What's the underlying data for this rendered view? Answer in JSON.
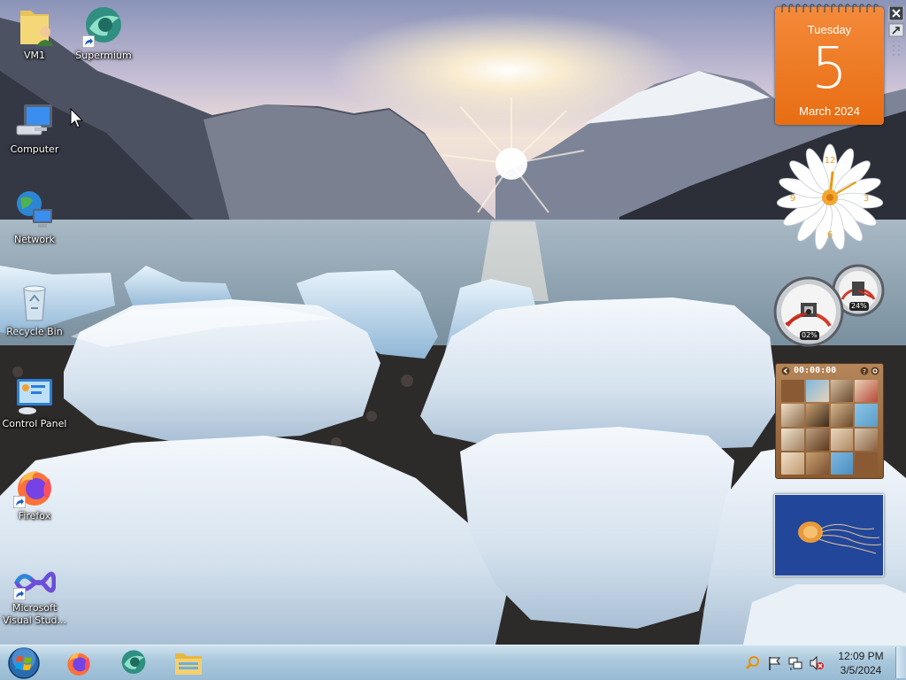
{
  "desktop": {
    "icons": [
      {
        "label": "VM1",
        "icon": "user-folder-icon",
        "shortcut": false
      },
      {
        "label": "Supermium",
        "icon": "supermium-icon",
        "shortcut": true
      },
      {
        "label": "Computer",
        "icon": "computer-icon",
        "shortcut": false
      },
      {
        "label": "Network",
        "icon": "network-icon",
        "shortcut": false
      },
      {
        "label": "Recycle Bin",
        "icon": "recycle-bin-icon",
        "shortcut": false
      },
      {
        "label": "Control Panel",
        "icon": "control-panel-icon",
        "shortcut": false
      },
      {
        "label": "Firefox",
        "icon": "firefox-icon",
        "shortcut": true
      },
      {
        "label": "Microsoft Visual Stud...",
        "icon": "visual-studio-icon",
        "shortcut": true
      }
    ]
  },
  "gadgets": {
    "calendar": {
      "day_name": "Tuesday",
      "date": "5",
      "month_year": "March 2024"
    },
    "cpu_meter": {
      "cpu_percent": "02%",
      "memory_percent": "24%"
    },
    "puzzle": {
      "timer": "00:00:00"
    },
    "colors": {
      "calendar_orange": "#ef7a22"
    }
  },
  "taskbar": {
    "pinned": [
      {
        "name": "Firefox",
        "icon": "firefox-icon"
      },
      {
        "name": "Supermium",
        "icon": "supermium-icon"
      },
      {
        "name": "File Explorer",
        "icon": "folder-icon"
      }
    ],
    "clock": {
      "time": "12:09 PM",
      "date": "3/5/2024"
    },
    "colors": {
      "bar": "#a9c7dc"
    }
  }
}
